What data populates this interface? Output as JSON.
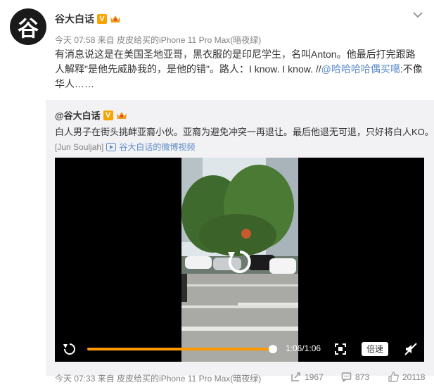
{
  "post": {
    "avatar_glyph": "谷",
    "author": "谷大白话",
    "verified_badge": "V",
    "time": "今天 07:58",
    "source_prefix": "来自",
    "source": "皮皮给买的iPhone 11 Pro Max(暗夜绿)",
    "text_part1": "有消息说这是在美国圣地亚哥，黑衣服的是印尼学生，名叫Anton。他最后打完跟路人解释\"是他先威胁我的，是他的错\"。路人：I know. I know. //",
    "mention": "@哈哈哈哈偶买噶",
    "text_part2": ":不像华人……"
  },
  "repost": {
    "author": "@谷大白话",
    "verified_badge": "V",
    "text": "白人男子在街头挑衅亚裔小伙。亚裔为避免冲突一再退让。最后他退无可退，只好将白人KO。",
    "credit": "[Jun Souljah]",
    "video_link": "谷大白话的微博视频",
    "video": {
      "progress": 1.0,
      "time": "1:06/1:06",
      "speed_label": "倍速"
    },
    "footer": {
      "time": "今天 07:33",
      "source_prefix": "来自",
      "source": "皮皮给买的iPhone 11 Pro Max(暗夜绿)",
      "reposts": "1967",
      "comments": "873",
      "likes": "20118"
    }
  },
  "colors": {
    "accent": "#ff9900",
    "link": "#5e8bc8",
    "verified": "#f7a400"
  }
}
